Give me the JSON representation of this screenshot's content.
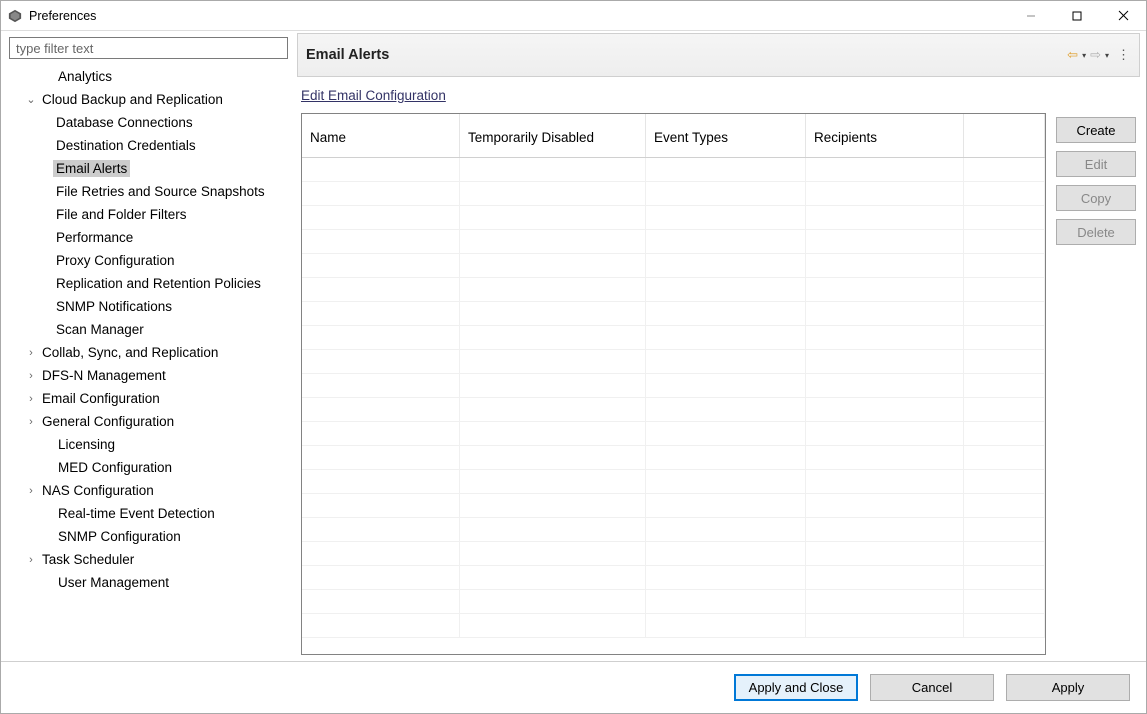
{
  "window": {
    "title": "Preferences"
  },
  "sidebar": {
    "filter_placeholder": "type filter text",
    "items": [
      {
        "label": "Analytics",
        "depth": 1,
        "arrow": "none"
      },
      {
        "label": "Cloud Backup and Replication",
        "depth": 1,
        "arrow": "expanded"
      },
      {
        "label": "Database Connections",
        "depth": 2,
        "arrow": "none"
      },
      {
        "label": "Destination Credentials",
        "depth": 2,
        "arrow": "none"
      },
      {
        "label": "Email Alerts",
        "depth": 2,
        "arrow": "none",
        "selected": true
      },
      {
        "label": "File Retries and Source Snapshots",
        "depth": 2,
        "arrow": "none"
      },
      {
        "label": "File and Folder Filters",
        "depth": 2,
        "arrow": "none"
      },
      {
        "label": "Performance",
        "depth": 2,
        "arrow": "none"
      },
      {
        "label": "Proxy Configuration",
        "depth": 2,
        "arrow": "none"
      },
      {
        "label": "Replication and Retention Policies",
        "depth": 2,
        "arrow": "none"
      },
      {
        "label": "SNMP Notifications",
        "depth": 2,
        "arrow": "none"
      },
      {
        "label": "Scan Manager",
        "depth": 2,
        "arrow": "none"
      },
      {
        "label": "Collab, Sync, and Replication",
        "depth": 1,
        "arrow": "collapsed"
      },
      {
        "label": "DFS-N Management",
        "depth": 1,
        "arrow": "collapsed"
      },
      {
        "label": "Email Configuration",
        "depth": 1,
        "arrow": "collapsed"
      },
      {
        "label": "General Configuration",
        "depth": 1,
        "arrow": "collapsed"
      },
      {
        "label": "Licensing",
        "depth": 1,
        "arrow": "none"
      },
      {
        "label": "MED Configuration",
        "depth": 1,
        "arrow": "none"
      },
      {
        "label": "NAS Configuration",
        "depth": 1,
        "arrow": "collapsed"
      },
      {
        "label": "Real-time Event Detection",
        "depth": 1,
        "arrow": "none"
      },
      {
        "label": "SNMP Configuration",
        "depth": 1,
        "arrow": "none"
      },
      {
        "label": "Task Scheduler",
        "depth": 1,
        "arrow": "collapsed"
      },
      {
        "label": "User Management",
        "depth": 1,
        "arrow": "none"
      }
    ]
  },
  "main": {
    "title": "Email Alerts",
    "edit_link": "Edit Email Configuration",
    "columns": [
      "Name",
      "Temporarily Disabled",
      "Event Types",
      "Recipients"
    ],
    "rows": [],
    "empty_row_count": 20,
    "buttons": {
      "create": "Create",
      "edit": "Edit",
      "copy": "Copy",
      "delete": "Delete"
    }
  },
  "footer": {
    "apply_close": "Apply and Close",
    "cancel": "Cancel",
    "apply": "Apply"
  }
}
